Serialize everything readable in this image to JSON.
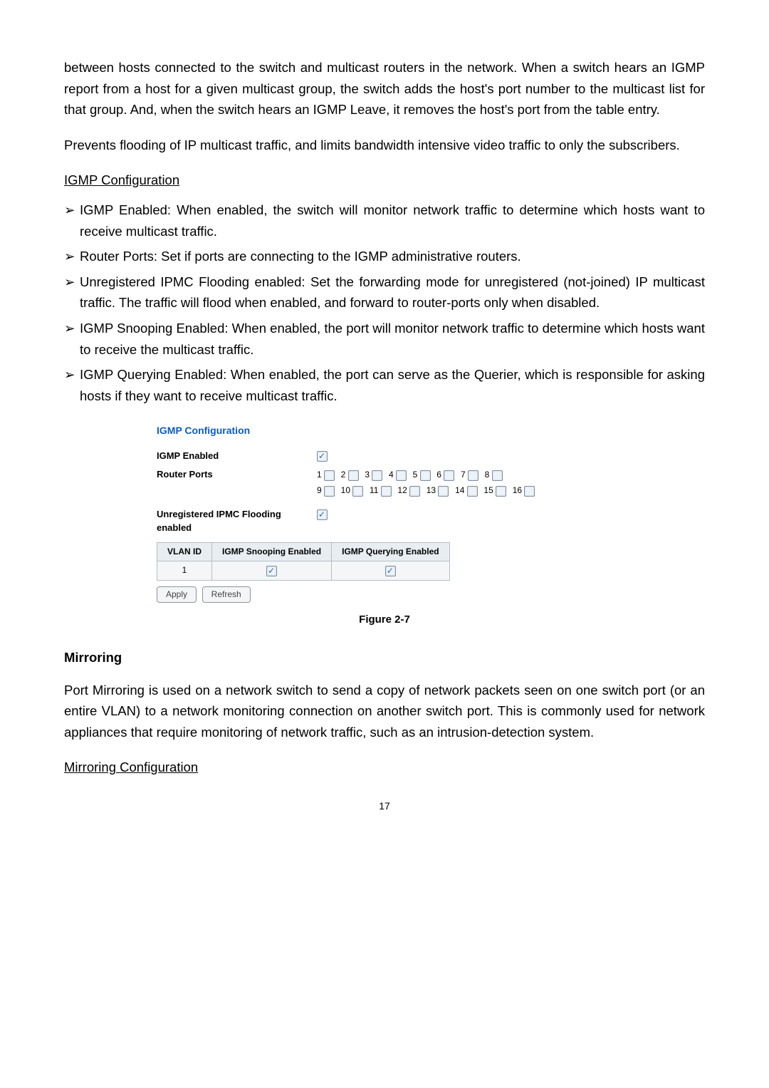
{
  "para1": "between hosts connected to the switch and multicast routers in the network. When a switch hears an IGMP report from a host for a given multicast group, the switch adds the host's port number to the multicast list for that group. And, when the switch hears an IGMP Leave, it removes the host's port from the table entry.",
  "para2": "Prevents flooding of IP multicast traffic, and limits bandwidth intensive video traffic to only the subscribers.",
  "sec_igmp_config": "IGMP Configuration",
  "bullets": [
    "IGMP Enabled: When enabled, the switch will monitor network traffic to determine which hosts want to receive multicast traffic.",
    "Router Ports: Set if ports are connecting to the IGMP administrative routers.",
    "Unregistered IPMC Flooding enabled: Set the forwarding mode for unregistered (not-joined) IP multicast traffic. The traffic will flood when enabled, and forward to router-ports only when disabled.",
    "IGMP Snooping Enabled: When enabled, the port will monitor network traffic to determine which hosts want to receive the multicast traffic.",
    "IGMP Querying Enabled: When enabled, the port can serve as the Querier, which is responsible for asking hosts if they want to receive multicast traffic."
  ],
  "config": {
    "title": "IGMP Configuration",
    "row_enabled": "IGMP Enabled",
    "row_router_ports": "Router Ports",
    "row_unreg": "Unregistered IPMC Flooding enabled",
    "ports_row1": [
      "1",
      "2",
      "3",
      "4",
      "5",
      "6",
      "7",
      "8"
    ],
    "ports_row2": [
      "9",
      "10",
      "11",
      "12",
      "13",
      "14",
      "15",
      "16"
    ],
    "table": {
      "h1": "VLAN ID",
      "h2": "IGMP Snooping Enabled",
      "h3": "IGMP Querying Enabled",
      "r1c1": "1"
    },
    "btn_apply": "Apply",
    "btn_refresh": "Refresh"
  },
  "fig_caption": "Figure 2-7",
  "mirroring_head": "Mirroring",
  "mirroring_para": "Port Mirroring is used on a network switch to send a copy of network packets seen on one switch port (or an entire VLAN) to a network monitoring connection on another switch port. This is commonly used for network appliances that require monitoring of network traffic, such as an intrusion-detection system.",
  "sec_mirror_config": "Mirroring Configuration",
  "page_number": "17"
}
